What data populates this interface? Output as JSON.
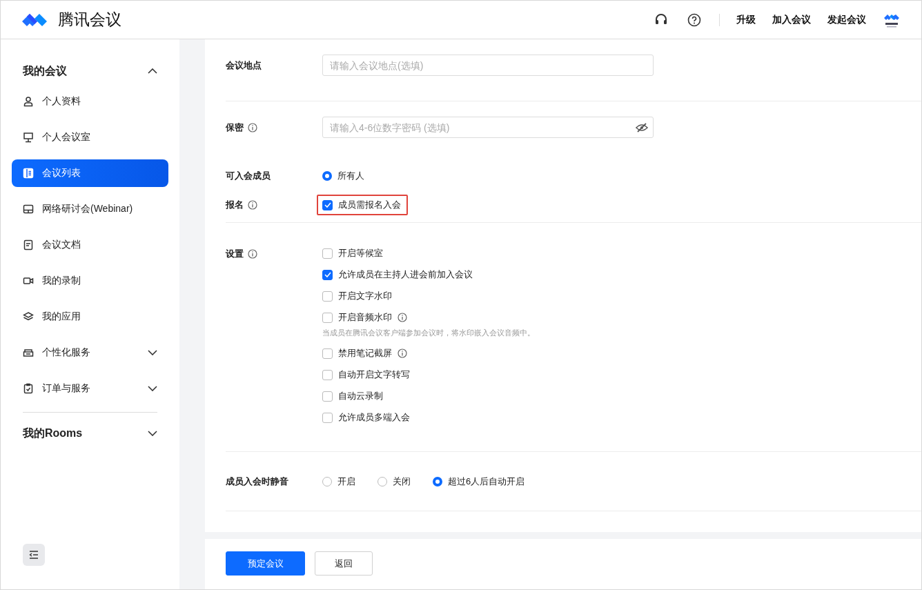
{
  "header": {
    "brand": "腾讯会议",
    "links": [
      "升级",
      "加入会议",
      "发起会议"
    ]
  },
  "sidebar": {
    "groups": [
      {
        "label": "我的会议",
        "expanded": true,
        "items": [
          {
            "label": "个人资料",
            "selected": false
          },
          {
            "label": "个人会议室",
            "selected": false
          },
          {
            "label": "会议列表",
            "selected": true
          },
          {
            "label": "网络研讨会(Webinar)",
            "selected": false
          },
          {
            "label": "会议文档",
            "selected": false
          },
          {
            "label": "我的录制",
            "selected": false
          },
          {
            "label": "我的应用",
            "selected": false
          },
          {
            "label": "个性化服务",
            "selected": false,
            "expanded": false
          },
          {
            "label": "订单与服务",
            "selected": false,
            "expanded": false
          }
        ]
      },
      {
        "label": "我的Rooms",
        "expanded": false
      }
    ]
  },
  "form": {
    "location": {
      "label": "会议地点",
      "placeholder": "请输入会议地点(选填)"
    },
    "password": {
      "label": "保密",
      "placeholder": "请输入4-6位数字密码 (选填)"
    },
    "members": {
      "label": "可入会成员",
      "options": [
        {
          "label": "所有人",
          "selected": true
        }
      ]
    },
    "registration": {
      "label": "报名",
      "option": {
        "label": "成员需报名入会",
        "checked": true
      }
    },
    "settings": {
      "label": "设置",
      "options": [
        {
          "label": "开启等候室",
          "checked": false,
          "info": false
        },
        {
          "label": "允许成员在主持人进会前加入会议",
          "checked": true,
          "info": false
        },
        {
          "label": "开启文字水印",
          "checked": false,
          "info": false
        },
        {
          "label": "开启音频水印",
          "checked": false,
          "info": true,
          "hint": "当成员在腾讯会议客户端参加会议时，将水印嵌入会议音频中。"
        },
        {
          "label": "禁用笔记截屏",
          "checked": false,
          "info": true
        },
        {
          "label": "自动开启文字转写",
          "checked": false,
          "info": false
        },
        {
          "label": "自动云录制",
          "checked": false,
          "info": false
        },
        {
          "label": "允许成员多端入会",
          "checked": false,
          "info": false
        }
      ]
    },
    "mute": {
      "label": "成员入会时静音",
      "options": [
        {
          "label": "开启",
          "selected": false
        },
        {
          "label": "关闭",
          "selected": false
        },
        {
          "label": "超过6人后自动开启",
          "selected": true
        }
      ]
    }
  },
  "buttons": {
    "primary": "预定会议",
    "secondary": "返回"
  }
}
